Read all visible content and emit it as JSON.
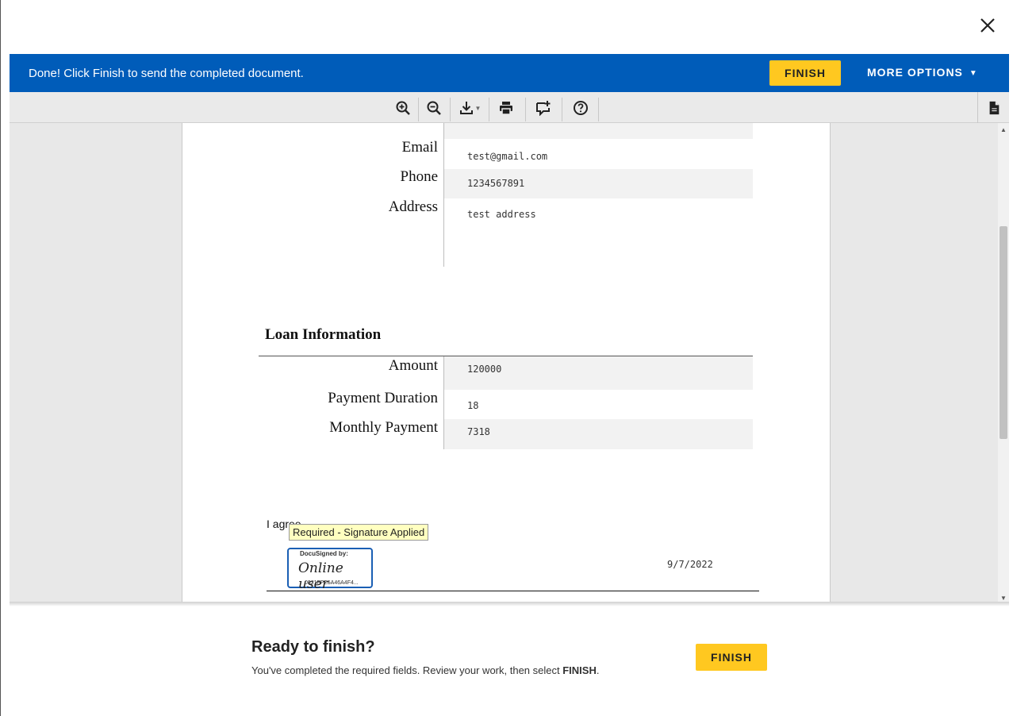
{
  "dialog": {
    "close_icon": "close-icon"
  },
  "banner": {
    "message": "Done! Click Finish to send the completed document.",
    "finish_label": "FINISH",
    "more_options_label": "MORE OPTIONS",
    "background": "#005cb9",
    "button_color": "#ffc820"
  },
  "toolbar": {
    "icons": [
      "zoom-in-icon",
      "zoom-out-icon",
      "download-icon",
      "print-icon",
      "add-comment-icon",
      "help-icon",
      "document-icon"
    ]
  },
  "document": {
    "contact_fields": [
      {
        "label": "Email",
        "value": "test@gmail.com"
      },
      {
        "label": "Phone",
        "value": "1234567891"
      },
      {
        "label": "Address",
        "value": "test address"
      }
    ],
    "loan_section_title": "Loan Information",
    "loan_fields": [
      {
        "label": "Amount",
        "value": "120000"
      },
      {
        "label": "Payment Duration",
        "value": "18"
      },
      {
        "label": "Monthly Payment",
        "value": "7318"
      }
    ],
    "agree_text": "I agree",
    "signature_tooltip": "Required - Signature Applied",
    "signature": {
      "header": "DocuSigned by:",
      "name": "Online user",
      "id": "0921FFE5A46A4F4..."
    },
    "date": "9/7/2022"
  },
  "footer": {
    "title": "Ready to finish?",
    "message_prefix": "You've completed the required fields. Review your work, then select ",
    "message_bold": "FINISH",
    "message_suffix": ".",
    "finish_label": "FINISH"
  }
}
